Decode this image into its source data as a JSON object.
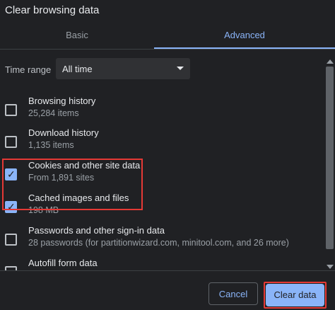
{
  "dialog": {
    "title": "Clear browsing data"
  },
  "tabs": [
    {
      "label": "Basic",
      "active": false
    },
    {
      "label": "Advanced",
      "active": true
    }
  ],
  "time_range": {
    "label": "Time range",
    "value": "All time"
  },
  "items": [
    {
      "title": "Browsing history",
      "subtitle": "25,284 items",
      "checked": false
    },
    {
      "title": "Download history",
      "subtitle": "1,135 items",
      "checked": false
    },
    {
      "title": "Cookies and other site data",
      "subtitle": "From 1,891 sites",
      "checked": true
    },
    {
      "title": "Cached images and files",
      "subtitle": "198 MB",
      "checked": true
    },
    {
      "title": "Passwords and other sign-in data",
      "subtitle": "28 passwords (for partitionwizard.com, minitool.com, and 26 more)",
      "checked": false
    },
    {
      "title": "Autofill form data",
      "subtitle": "",
      "checked": false
    }
  ],
  "buttons": {
    "cancel": "Cancel",
    "clear": "Clear data"
  },
  "colors": {
    "accent": "#8ab4f8",
    "background": "#202124",
    "highlight": "#e53935"
  },
  "icons": {
    "checkbox_checked": "check-icon",
    "dropdown": "chevron-down-icon"
  }
}
